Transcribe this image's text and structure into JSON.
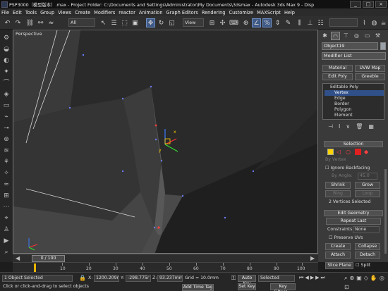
{
  "title": "PSP3000（模型版本）.max  -  Project Folder: C:\\Documents and Settings\\Administrator\\My Documents\\3dsmax  -  Autodesk 3ds Max 9  -  Disp",
  "window_buttons": [
    "_",
    "□",
    "×"
  ],
  "menu": [
    "File",
    "Edit",
    "Tools",
    "Group",
    "Views",
    "Create",
    "Modifiers",
    "reactor",
    "Animation",
    "Graph Editors",
    "Rendering",
    "Customize",
    "MAXScript",
    "Help"
  ],
  "toolbar": {
    "selection_filter": "All",
    "ref_coord": "View",
    "named_selection": ""
  },
  "viewport": {
    "label": "Perspective",
    "gizmo_x": "x",
    "gizmo_y": "y",
    "gizmo_z": "z"
  },
  "panel": {
    "object_name": "Object19",
    "modifier_list": "Modifier List",
    "buttons": [
      "Material",
      "UVW Map",
      "Edit Poly",
      "Greeble"
    ],
    "stack": [
      "Editable Poly",
      "Vertex",
      "Edge",
      "Border",
      "Polygon",
      "Element"
    ],
    "stack_selected": "Vertex",
    "selection_title": "Selection",
    "by_vertex": "By Vertex",
    "ignore_backfacing": "Ignore Backfacing",
    "by_angle": "By Angle:",
    "angle_value": "45.0",
    "shrink": "Shrink",
    "grow": "Grow",
    "ring": "Ring",
    "loop": "Loop",
    "selected_info": "2 Vertices Selected",
    "edit_geometry_title": "Edit Geometry",
    "repeat_last": "Repeat Last",
    "constraints": "Constraints:",
    "constraints_value": "None",
    "preserve_uvs": "Preserve UVs",
    "create": "Create",
    "collapse": "Collapse",
    "attach": "Attach",
    "detach": "Detach",
    "slice_plane": "Slice Plane",
    "split": "Split"
  },
  "timeline": {
    "slider": "0 / 100",
    "ticks": [
      "10",
      "20",
      "30",
      "40",
      "50",
      "60",
      "70",
      "80",
      "90",
      "100"
    ]
  },
  "status": {
    "selected": "1 Object Selected",
    "prompt": "Click or click-and-drag to select objects",
    "x_label": "X:",
    "x_value": "1200.209r",
    "y_label": "Y:",
    "y_value": "-298.775r",
    "z_label": "Z:",
    "z_value": "93.237mm",
    "grid": "Grid = 10.0mm",
    "add_time_tag": "Add Time Tag",
    "auto_key": "Auto Key",
    "set_key": "Set Key",
    "key_mode": "Selected",
    "key_filters": "Key Filters..."
  }
}
